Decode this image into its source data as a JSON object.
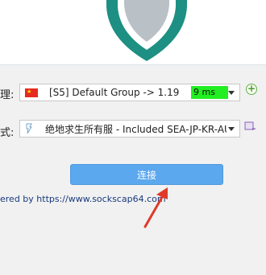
{
  "proxy_row": {
    "label": "理:",
    "flag_icon": "china-flag-icon",
    "text": "[S5] Default Group -> 1.194.237...",
    "ping": "9 ms",
    "ping_color": "#22ee22"
  },
  "rule_row": {
    "label": "式:",
    "icon": "route-rule-icon",
    "text": "绝地求生所有服 - Included SEA-JP-KR-AU..."
  },
  "connect_button": {
    "label": "连接",
    "color": "#5ba8ee"
  },
  "footer": {
    "powered_by": "ered by https://www.sockscap64.com"
  },
  "annotation": {
    "arrow_color": "#e03a2a"
  }
}
